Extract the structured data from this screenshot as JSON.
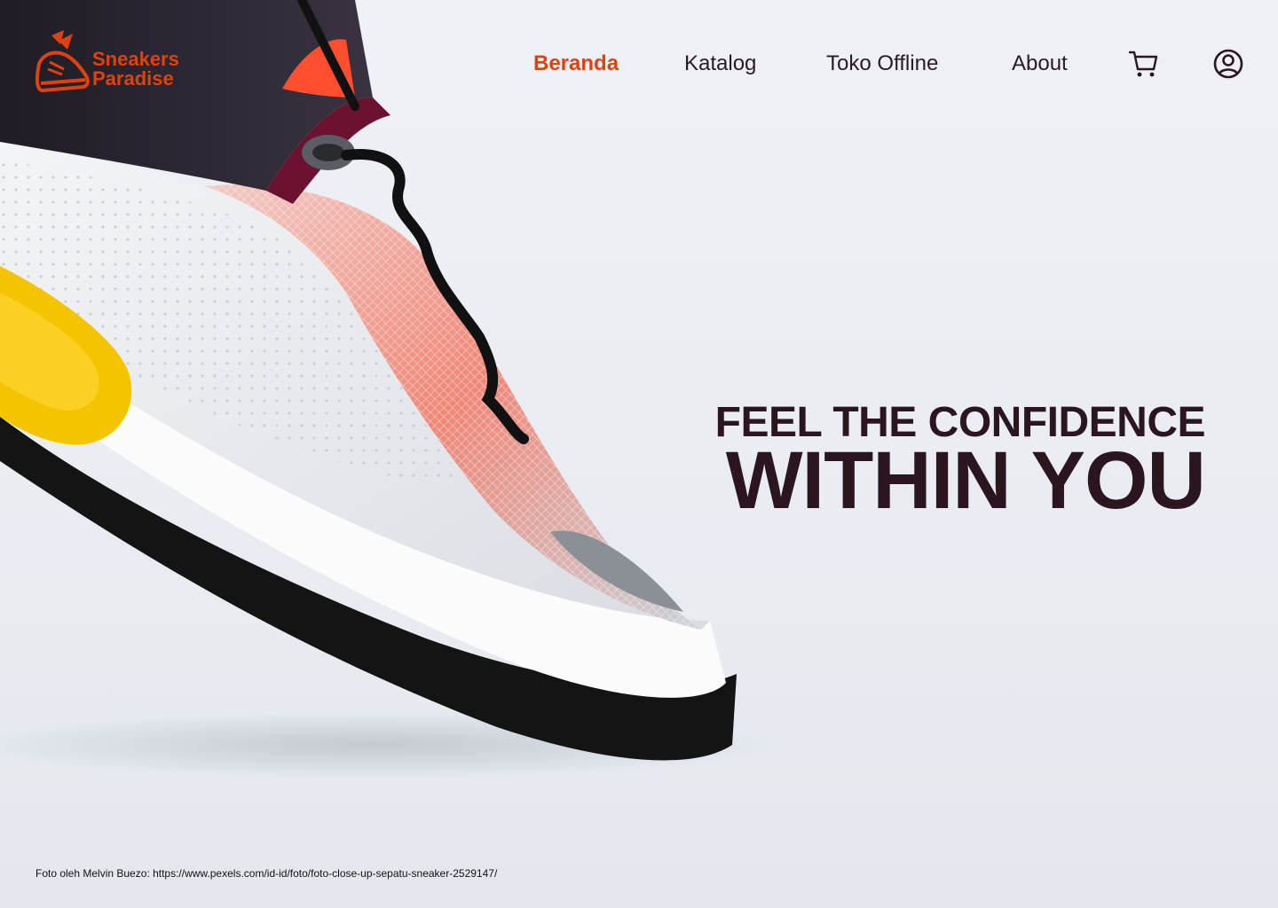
{
  "brand": {
    "line1": "Sneakers",
    "line2": "Paradise",
    "color": "#e0420f"
  },
  "nav": {
    "items": [
      {
        "label": "Beranda",
        "active": true
      },
      {
        "label": "Katalog",
        "active": false
      },
      {
        "label": "Toko Offline",
        "active": false
      },
      {
        "label": "About",
        "active": false
      }
    ],
    "icons": [
      "cart-icon",
      "account-icon"
    ]
  },
  "hero": {
    "headline_top": "FEEL THE CONFIDENCE",
    "headline_bottom": "WITHIN YOU",
    "image": "sneaker-closeup"
  },
  "footer": {
    "credit": "Foto oleh Melvin Buezo: https://www.pexels.com/id-id/foto/foto-close-up-sepatu-sneaker-2529147/"
  },
  "colors": {
    "accent": "#e0420f",
    "text_dark": "#2b1620",
    "background": "#e9edf2"
  }
}
